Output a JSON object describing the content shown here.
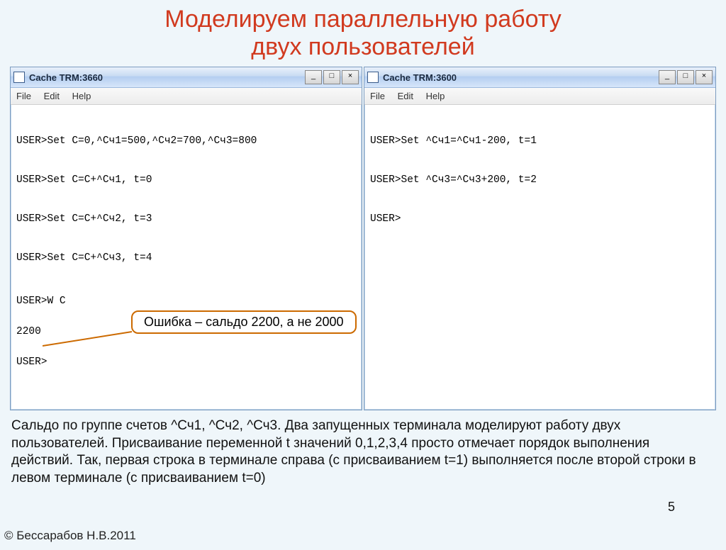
{
  "title_line1": "Моделируем параллельную работу",
  "title_line2": "двух пользователей",
  "left_window": {
    "title": "Cache TRM:3660",
    "menu": {
      "file": "File",
      "edit": "Edit",
      "help": "Help"
    },
    "lines": {
      "l0": "USER>Set C=0,^Сч1=500,^Сч2=700,^Сч3=800",
      "l1": "USER>Set C=C+^Сч1, t=0",
      "l2": "USER>Set C=C+^Сч2, t=3",
      "l3": "USER>Set C=C+^Сч3, t=4",
      "l4": "USER>W C",
      "l5": "2200",
      "l6": "USER>"
    }
  },
  "right_window": {
    "title": "Cache TRM:3600",
    "menu": {
      "file": "File",
      "edit": "Edit",
      "help": "Help"
    },
    "lines": {
      "l0": "USER>Set ^Сч1=^Сч1-200, t=1",
      "l1": "USER>Set ^Сч3=^Сч3+200, t=2",
      "l2": "USER>"
    }
  },
  "win_buttons": {
    "min": "_",
    "max": "□",
    "close": "×"
  },
  "callout": "Ошибка – сальдо 2200, а не 2000",
  "explain": "Сальдо по группе счетов ^Сч1, ^Сч2, ^Сч3. Два запущенных терминала моделируют работу двух пользователей. Присваивание переменной t значений 0,1,2,3,4 просто отмечает порядок выполнения действий. Так, первая строка в терминале справа (с присваиванием t=1) выполняется после второй строки в левом терминале (с присваиванием t=0)",
  "page_number": "5",
  "copyright": "© Бессарабов Н.В.2011"
}
